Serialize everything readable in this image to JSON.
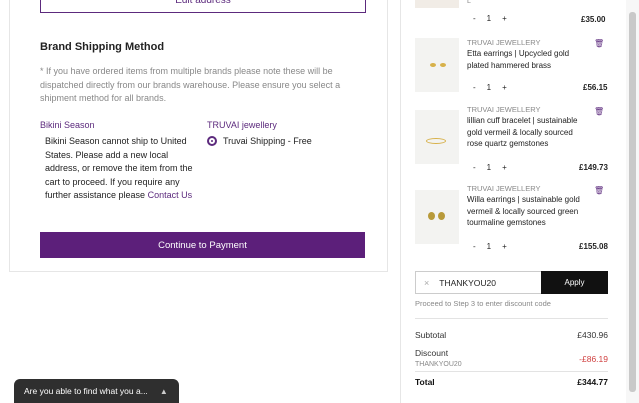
{
  "edit_address_label": "Edit address",
  "shipping": {
    "heading": "Brand Shipping Method",
    "note": "* If you have ordered items from multiple brands please note these will be dispatched directly from our brands warehouse. Please ensure you select a shipment method for all brands.",
    "bikini_brand": "Bikini Season",
    "bikini_message": "Bikini Season cannot ship to United States. Please add a new local address, or remove the item from the cart to proceed. If you require any further assistance please",
    "contact_link": "Contact Us",
    "truvai_brand": "TRUVAI jewellery",
    "truvai_option": "Truvai Shipping - Free"
  },
  "continue_label": "Continue to Payment",
  "cart": {
    "top_item": {
      "qty": "1",
      "price": "£35.00",
      "small": "L"
    },
    "items": [
      {
        "brand": "TRUVAI JEWELLERY",
        "title": "Etta earrings | Upcycled gold plated hammered brass",
        "qty": "1",
        "price": "£56.15"
      },
      {
        "brand": "TRUVAI JEWELLERY",
        "title": "lillian cuff bracelet | sustainable gold vermeil & locally sourced rose quartz gemstones",
        "qty": "1",
        "price": "£149.73"
      },
      {
        "brand": "TRUVAI JEWELLERY",
        "title": "Willa earrings | sustainable gold vermeil & locally sourced green tourmaline gemstones",
        "qty": "1",
        "price": "£155.08"
      }
    ],
    "minus": "-",
    "plus": "+"
  },
  "discount": {
    "code_value": "THANKYOU20",
    "apply_label": "Apply",
    "hint": "Proceed to Step 3 to enter discount code",
    "clear_glyph": "×"
  },
  "summary": {
    "subtotal_label": "Subtotal",
    "subtotal_value": "£430.96",
    "discount_label": "Discount",
    "discount_code": "THANKYOU20",
    "discount_value": "-£86.19",
    "total_label": "Total",
    "total_value": "£344.77"
  },
  "chat": {
    "label": "Are you able to find what you a...",
    "chevron": "▲"
  },
  "icons": {
    "trash": "🗑"
  },
  "colors": {
    "brand_purple": "#5c1f7a",
    "discount_red": "#d04040"
  }
}
